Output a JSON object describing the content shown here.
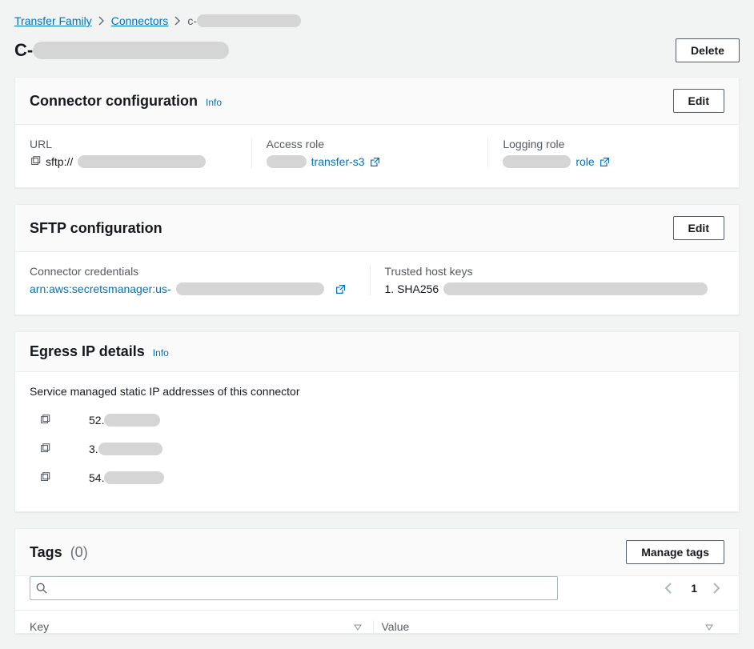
{
  "breadcrumb": {
    "root": "Transfer Family",
    "connectors": "Connectors",
    "currentPrefix": "c-"
  },
  "pageTitle": {
    "prefix": "C-"
  },
  "actions": {
    "delete": "Delete"
  },
  "connectorConfig": {
    "title": "Connector configuration",
    "info": "Info",
    "editLabel": "Edit",
    "url": {
      "label": "URL",
      "prefix": "sftp://"
    },
    "accessRole": {
      "label": "Access role",
      "suffix": "transfer-s3"
    },
    "loggingRole": {
      "label": "Logging role",
      "suffix": "role"
    }
  },
  "sftpConfig": {
    "title": "SFTP configuration",
    "editLabel": "Edit",
    "credentials": {
      "label": "Connector credentials",
      "prefix": "arn:aws:secretsmanager:us-"
    },
    "trustedKeys": {
      "label": "Trusted host keys",
      "item1Prefix": "1. SHA256"
    }
  },
  "egress": {
    "title": "Egress IP details",
    "info": "Info",
    "description": "Service managed static IP addresses of this connector",
    "ips": [
      {
        "prefix": "52."
      },
      {
        "prefix": "3."
      },
      {
        "prefix": "54."
      }
    ]
  },
  "tags": {
    "title": "Tags",
    "count": "(0)",
    "manage": "Manage tags",
    "searchPlaceholder": "",
    "page": "1",
    "keyHeader": "Key",
    "valueHeader": "Value"
  }
}
